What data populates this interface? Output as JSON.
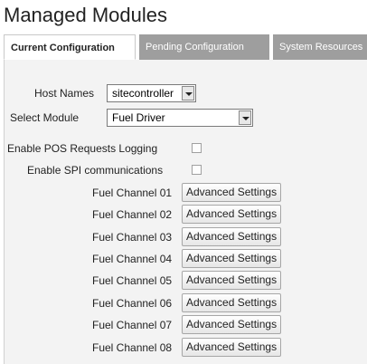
{
  "page": {
    "title": "Managed Modules"
  },
  "tabs": [
    {
      "label": "Current Configuration"
    },
    {
      "label": "Pending Configuration"
    },
    {
      "label": "System Resources"
    }
  ],
  "form": {
    "host_names_label": "Host Names",
    "host_names_value": "sitecontroller",
    "select_module_label": "Select Module",
    "select_module_value": "Fuel Driver",
    "pos_logging_label": "Enable POS Requests Logging",
    "spi_comm_label": "Enable SPI communications"
  },
  "channels": [
    {
      "label": "Fuel Channel 01",
      "button": "Advanced Settings"
    },
    {
      "label": "Fuel Channel 02",
      "button": "Advanced Settings"
    },
    {
      "label": "Fuel Channel 03",
      "button": "Advanced Settings"
    },
    {
      "label": "Fuel Channel 04",
      "button": "Advanced Settings"
    },
    {
      "label": "Fuel Channel 05",
      "button": "Advanced Settings"
    },
    {
      "label": "Fuel Channel 06",
      "button": "Advanced Settings"
    },
    {
      "label": "Fuel Channel 07",
      "button": "Advanced Settings"
    },
    {
      "label": "Fuel Channel 08",
      "button": "Advanced Settings"
    }
  ]
}
